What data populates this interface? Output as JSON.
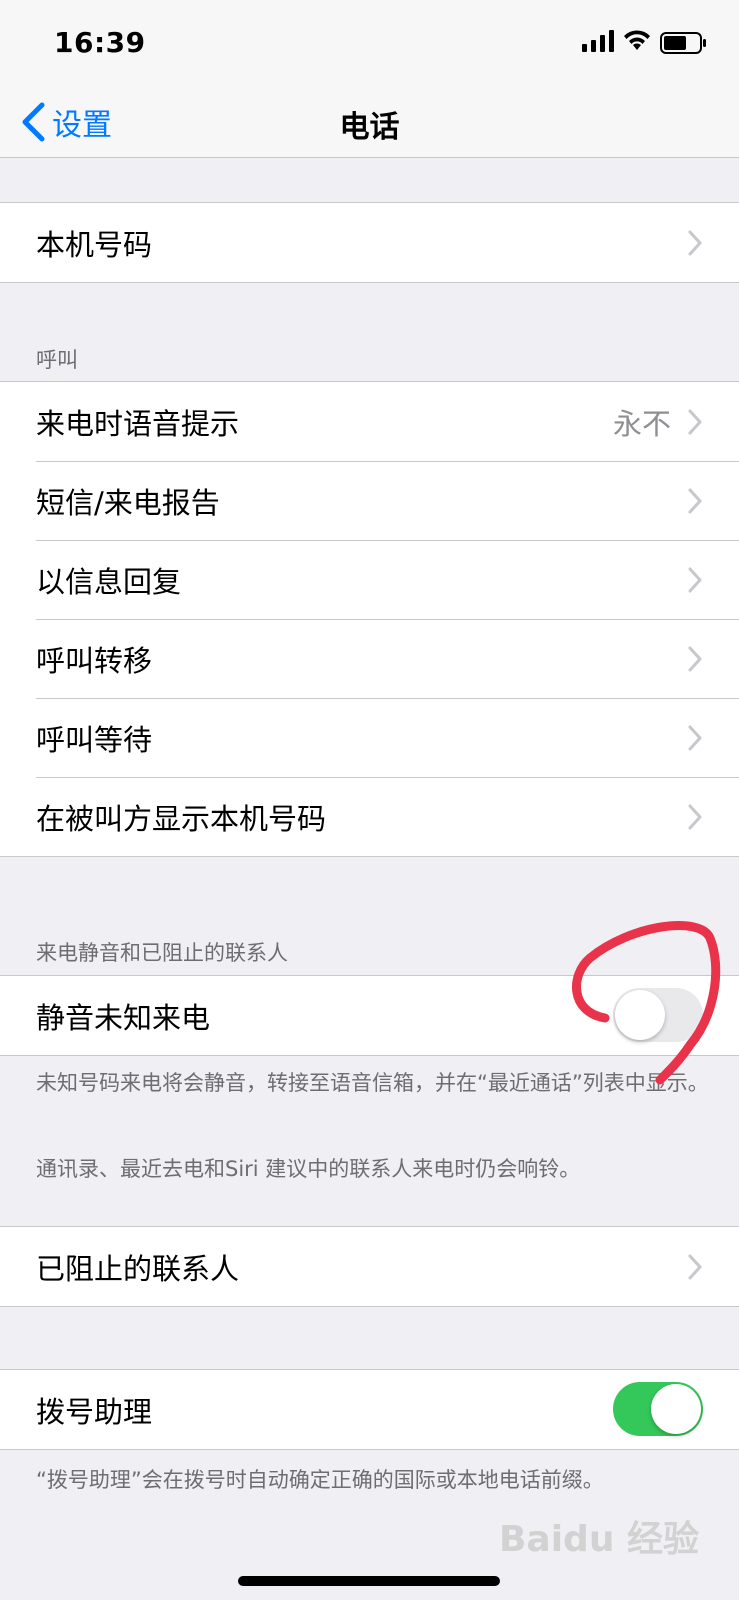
{
  "status_bar": {
    "time": "16:39"
  },
  "nav": {
    "back_label": "设置",
    "title": "电话"
  },
  "group1": [
    {
      "label": "本机号码"
    }
  ],
  "calls": {
    "header": "呼叫",
    "items": [
      {
        "label": "来电时语音提示",
        "value": "永不"
      },
      {
        "label": "短信/来电报告"
      },
      {
        "label": "以信息回复"
      },
      {
        "label": "呼叫转移"
      },
      {
        "label": "呼叫等待"
      },
      {
        "label": "在被叫方显示本机号码"
      }
    ]
  },
  "silence": {
    "header": "来电静音和已阻止的联系人",
    "toggle_label": "静音未知来电",
    "toggle_on": false,
    "footer1": "未知号码来电将会静音，转接至语音信箱，并在“最近通话”列表中显示。",
    "footer2": "通讯录、最近去电和Siri 建议中的联系人来电时仍会响铃。"
  },
  "blocked": {
    "label": "已阻止的联系人"
  },
  "dial_assist": {
    "label": "拨号助理",
    "toggle_on": true,
    "footer": "“拨号助理”会在拨号时自动确定正确的国际或本地电话前缀。"
  },
  "watermark": "Baidu 经验",
  "colors": {
    "accent": "#007aff",
    "toggle_on": "#34c759",
    "annotation": "#e8334a"
  }
}
